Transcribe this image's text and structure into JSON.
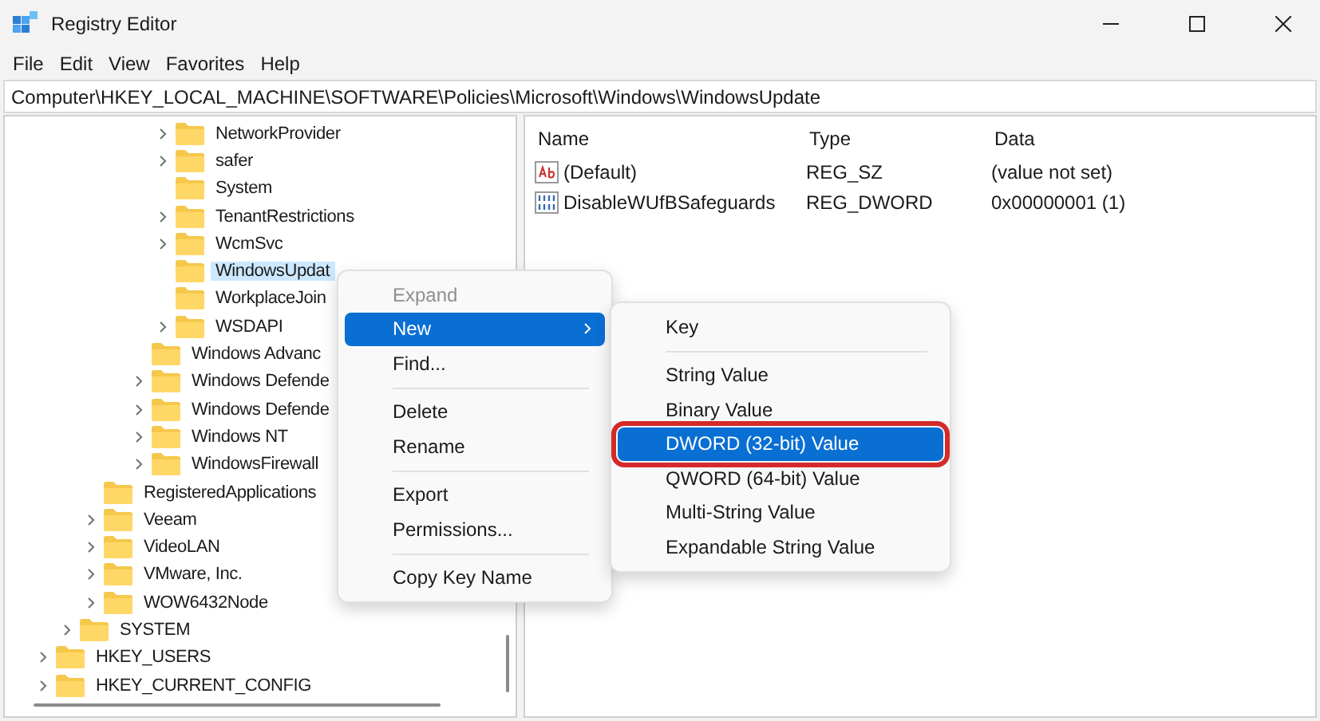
{
  "window": {
    "title": "Registry Editor"
  },
  "menu_bar": [
    "File",
    "Edit",
    "View",
    "Favorites",
    "Help"
  ],
  "address": "Computer\\HKEY_LOCAL_MACHINE\\SOFTWARE\\Policies\\Microsoft\\Windows\\WindowsUpdate",
  "tree": {
    "items": [
      {
        "children": [
          {
            "children": [
              {
                "children": [
                  {
                    "children": [
                      {
                        "children": [
                          {
                            "label": "NetworkProvider",
                            "expandable": true,
                            "selected": false
                          },
                          {
                            "label": "safer",
                            "expandable": true,
                            "selected": false
                          },
                          {
                            "label": "System",
                            "expandable": false,
                            "selected": false
                          },
                          {
                            "label": "TenantRestrictions",
                            "expandable": true,
                            "selected": false
                          },
                          {
                            "label": "WcmSvc",
                            "expandable": true,
                            "selected": false
                          },
                          {
                            "label": "WindowsUpdat",
                            "expandable": false,
                            "selected": true
                          },
                          {
                            "label": "WorkplaceJoin",
                            "expandable": false,
                            "selected": false
                          },
                          {
                            "label": "WSDAPI",
                            "expandable": true,
                            "selected": false
                          }
                        ]
                      },
                      {
                        "label": "Windows Advanc",
                        "expandable": false,
                        "selected": false
                      },
                      {
                        "label": "Windows Defende",
                        "expandable": true,
                        "selected": false
                      },
                      {
                        "label": "Windows Defende",
                        "expandable": true,
                        "selected": false
                      },
                      {
                        "label": "Windows NT",
                        "expandable": true,
                        "selected": false
                      },
                      {
                        "label": "WindowsFirewall",
                        "expandable": true,
                        "selected": false
                      }
                    ]
                  }
                ]
              },
              {
                "label": "RegisteredApplications",
                "expandable": false,
                "selected": false
              },
              {
                "label": "Veeam",
                "expandable": true,
                "selected": false
              },
              {
                "label": "VideoLAN",
                "expandable": true,
                "selected": false
              },
              {
                "label": "VMware, Inc.",
                "expandable": true,
                "selected": false
              },
              {
                "label": "WOW6432Node",
                "expandable": true,
                "selected": false
              }
            ]
          },
          {
            "label": "SYSTEM",
            "expandable": true,
            "selected": false
          }
        ]
      },
      {
        "label": "HKEY_USERS",
        "expandable": true,
        "selected": false
      },
      {
        "label": "HKEY_CURRENT_CONFIG",
        "expandable": true,
        "selected": false
      }
    ]
  },
  "values": {
    "columns": [
      "Name",
      "Type",
      "Data"
    ],
    "rows": [
      {
        "kind": "string",
        "name": "(Default)",
        "type": "REG_SZ",
        "data": "(value not set)"
      },
      {
        "kind": "binary",
        "name": "DisableWUfBSafeguards",
        "type": "REG_DWORD",
        "data": "0x00000001 (1)"
      }
    ]
  },
  "context_menu": {
    "items": [
      {
        "kind": "item",
        "label": "Expand",
        "disabled": true,
        "selected": false,
        "submenu": false
      },
      {
        "kind": "item",
        "label": "New",
        "disabled": false,
        "selected": true,
        "submenu": true
      },
      {
        "kind": "item",
        "label": "Find...",
        "disabled": false,
        "selected": false,
        "submenu": false
      },
      {
        "kind": "separator"
      },
      {
        "kind": "item",
        "label": "Delete",
        "disabled": false,
        "selected": false,
        "submenu": false
      },
      {
        "kind": "item",
        "label": "Rename",
        "disabled": false,
        "selected": false,
        "submenu": false
      },
      {
        "kind": "separator"
      },
      {
        "kind": "item",
        "label": "Export",
        "disabled": false,
        "selected": false,
        "submenu": false
      },
      {
        "kind": "item",
        "label": "Permissions...",
        "disabled": false,
        "selected": false,
        "submenu": false
      },
      {
        "kind": "separator"
      },
      {
        "kind": "item",
        "label": "Copy Key Name",
        "disabled": false,
        "selected": false,
        "submenu": false
      }
    ]
  },
  "submenu": {
    "items": [
      {
        "kind": "item",
        "label": "Key",
        "selected": false,
        "highlighted": false
      },
      {
        "kind": "separator"
      },
      {
        "kind": "item",
        "label": "String Value",
        "selected": false,
        "highlighted": false
      },
      {
        "kind": "item",
        "label": "Binary Value",
        "selected": false,
        "highlighted": false
      },
      {
        "kind": "item",
        "label": "DWORD (32-bit) Value",
        "selected": true,
        "highlighted": true
      },
      {
        "kind": "item",
        "label": "QWORD (64-bit) Value",
        "selected": false,
        "highlighted": false
      },
      {
        "kind": "item",
        "label": "Multi-String Value",
        "selected": false,
        "highlighted": false
      },
      {
        "kind": "item",
        "label": "Expandable String Value",
        "selected": false,
        "highlighted": false
      }
    ]
  }
}
